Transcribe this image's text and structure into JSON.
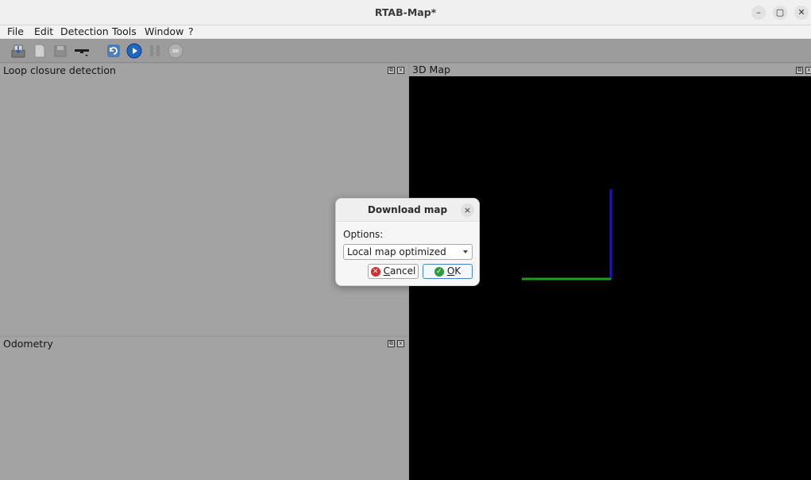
{
  "window": {
    "title": "RTAB-Map*",
    "minimize_glyph": "–",
    "maximize_glyph": "▢",
    "close_glyph": "✕"
  },
  "menubar": {
    "items": [
      "File",
      "Edit",
      "Detection",
      "Tools",
      "Window",
      "?"
    ]
  },
  "toolbar": {
    "icons": [
      "save-database-icon",
      "new-database-icon",
      "close-database-icon",
      "source-camera-icon",
      "refresh-icon",
      "start-icon",
      "pause-icon",
      "stop-icon"
    ]
  },
  "docks": {
    "loop_closure": {
      "title": "Loop closure detection"
    },
    "map3d": {
      "title": "3D Map"
    },
    "odometry": {
      "title": "Odometry"
    },
    "float_glyph": "⧉",
    "close_glyph": "x"
  },
  "dialog": {
    "title": "Download map",
    "close_glyph": "×",
    "options_label": "Options:",
    "selected_option": "Local map optimized",
    "cancel_label_first": "C",
    "cancel_label_rest": "ancel",
    "ok_label_first": "O",
    "ok_label_rest": "K"
  },
  "colors": {
    "map_background": "#000000",
    "axis_z": "#1c14c8",
    "axis_x": "#1aa01a",
    "cancel_icon": "#d62b2b",
    "ok_icon": "#2e9a3a"
  }
}
